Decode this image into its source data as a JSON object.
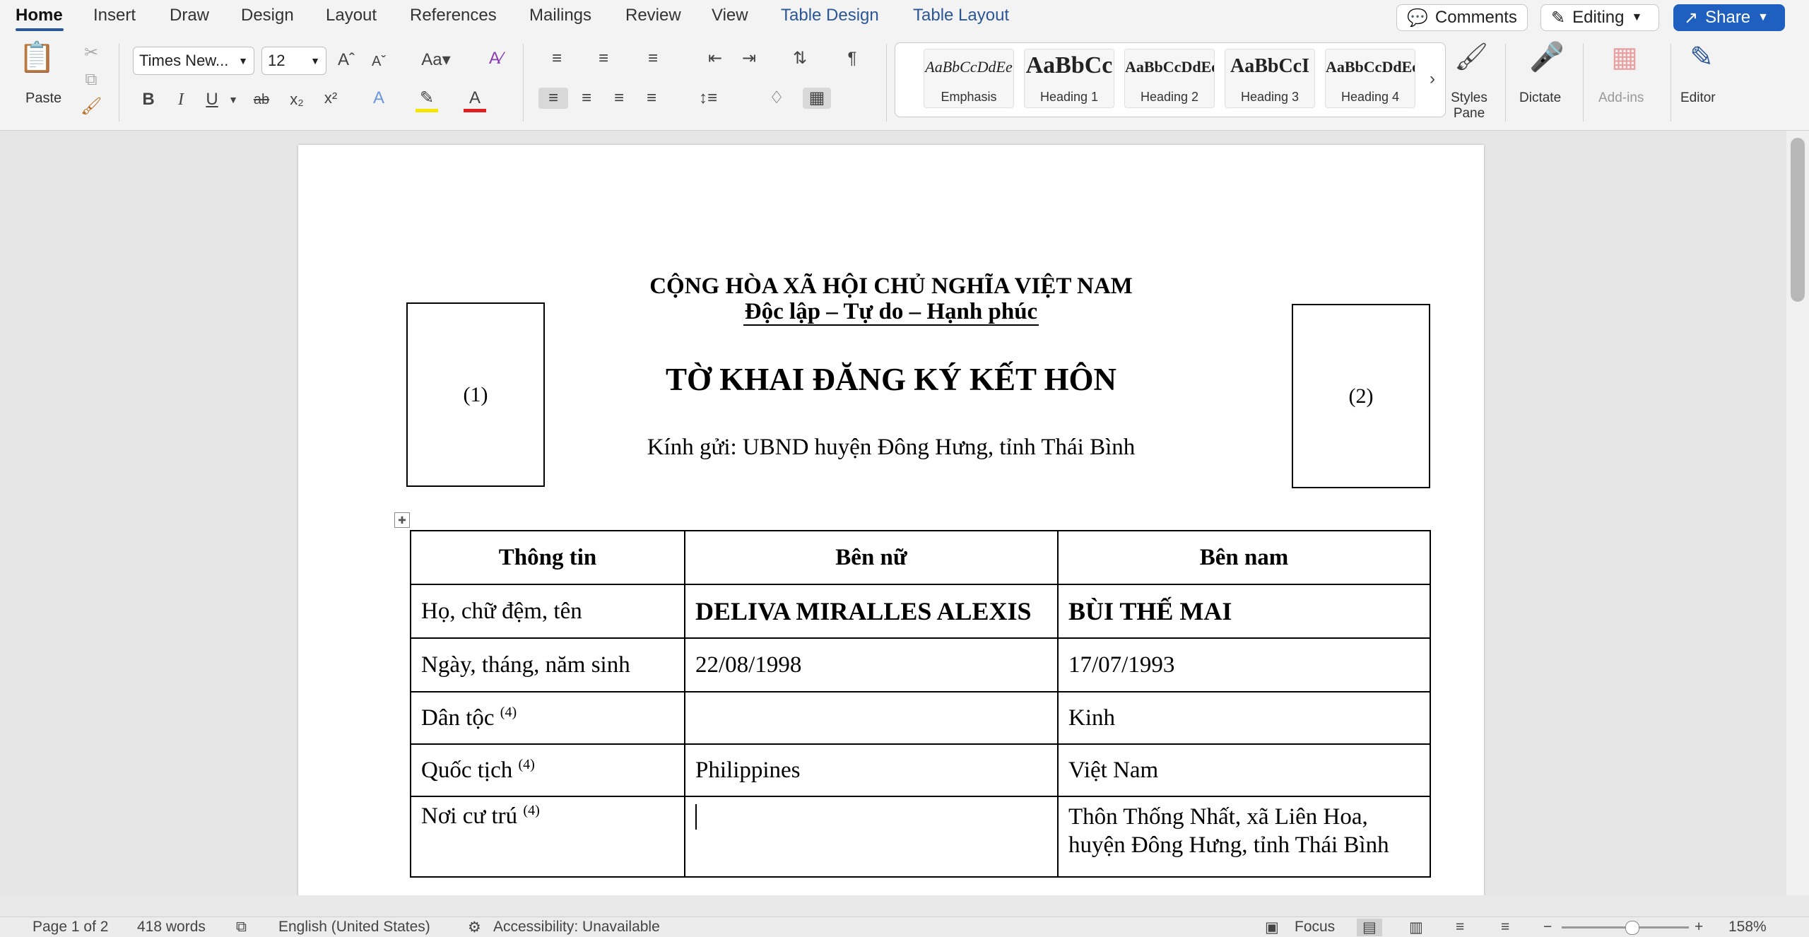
{
  "tabs": {
    "items": [
      {
        "label": "Home"
      },
      {
        "label": "Insert"
      },
      {
        "label": "Draw"
      },
      {
        "label": "Design"
      },
      {
        "label": "Layout"
      },
      {
        "label": "References"
      },
      {
        "label": "Mailings"
      },
      {
        "label": "Review"
      },
      {
        "label": "View"
      },
      {
        "label": "Table Design"
      },
      {
        "label": "Table Layout"
      }
    ],
    "active": "Home"
  },
  "topright": {
    "comments": "Comments",
    "editing": "Editing",
    "share": "Share"
  },
  "ribbon": {
    "paste": "Paste",
    "font_name": "Times New...",
    "font_size": "12",
    "styles": [
      {
        "sample": "AaBbCcDdEe",
        "name": "Emphasis"
      },
      {
        "sample": "AaBbCc",
        "name": "Heading 1"
      },
      {
        "sample": "AaBbCcDdEe",
        "name": "Heading 2"
      },
      {
        "sample": "AaBbCcI",
        "name": "Heading 3"
      },
      {
        "sample": "AaBbCcDdEe",
        "name": "Heading 4"
      }
    ],
    "styles_pane": "Styles Pane",
    "dictate": "Dictate",
    "addins": "Add-ins",
    "editor": "Editor"
  },
  "document": {
    "nation": "CỘNG HÒA XÃ HỘI CHỦ NGHĨA VIỆT NAM",
    "motto": "Độc lập – Tự do – Hạnh phúc",
    "title": "TỜ KHAI ĐĂNG KÝ KẾT HÔN",
    "recipient": "Kính gửi: UBND huyện Đông Hưng, tỉnh Thái Bình",
    "photo1": "(1)",
    "photo2": "(2)",
    "table": {
      "headers": [
        "Thông tin",
        "Bên nữ",
        "Bên nam"
      ],
      "rows": [
        {
          "label": "Họ, chữ đệm, tên",
          "sup": "",
          "female": "DELIVA MIRALLES ALEXIS",
          "male": "BÙI THẾ MAI"
        },
        {
          "label": "Ngày, tháng, năm sinh",
          "sup": "",
          "female": "22/08/1998",
          "male": "17/07/1993"
        },
        {
          "label": "Dân tộc",
          "sup": "(4)",
          "female": "",
          "male": "Kinh"
        },
        {
          "label": "Quốc tịch",
          "sup": "(4)",
          "female": "Philippines",
          "male": "Việt Nam"
        },
        {
          "label": "Nơi cư trú",
          "sup": "(4)",
          "female": "",
          "male": "Thôn Thống Nhất, xã Liên Hoa, huyện Đông Hưng, tỉnh Thái Bình"
        }
      ]
    }
  },
  "status": {
    "page": "Page 1 of 2",
    "words": "418 words",
    "language": "English (United States)",
    "accessibility": "Accessibility: Unavailable",
    "focus": "Focus",
    "zoom": "158%"
  }
}
